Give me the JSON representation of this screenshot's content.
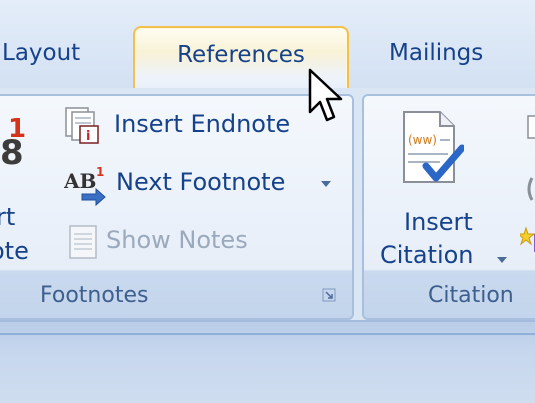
{
  "tabs": {
    "layout": "Layout",
    "references": "References",
    "mailings": "Mailings"
  },
  "footnotes_group": {
    "insert_footnote_line1": "rt",
    "insert_footnote_line2": "ote",
    "insert_footnote_badge": "1",
    "insert_endnote": "Insert Endnote",
    "next_footnote": "Next Footnote",
    "next_footnote_icon_text": "AB",
    "next_footnote_icon_sup": "1",
    "show_notes": "Show Notes",
    "title": "Footnotes"
  },
  "citations_group": {
    "insert_citation_line1": "Insert",
    "insert_citation_line2": "Citation",
    "citation_icon_text": "(ww)",
    "title": "Citation"
  },
  "colors": {
    "label_blue": "#15428b",
    "active_tab_border": "#f2c14d",
    "disabled_text": "#9aa9bc"
  }
}
